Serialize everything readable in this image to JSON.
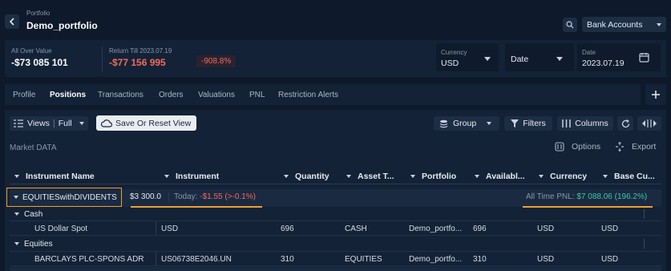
{
  "header": {
    "breadcrumb": "Portfolio",
    "title": "Demo_portfolio",
    "bank_accounts": "Bank Accounts"
  },
  "summary": {
    "all_over_label": "All Over Value",
    "all_over_value": "-$73 085 101",
    "return_label": "Return Till 2023.07.19",
    "return_value": "-$77 156 995",
    "return_pct": "-908.8%",
    "currency_label": "Currency",
    "currency_value": "USD",
    "date_select": "Date",
    "date_label": "Date",
    "date_value": "2023.07.19"
  },
  "tabs": [
    "Profile",
    "Positions",
    "Transactions",
    "Orders",
    "Valuations",
    "PNL",
    "Restriction Alerts"
  ],
  "toolbar": {
    "views": "Views",
    "views_mode": "Full",
    "save_reset": "Save Or Reset View",
    "group": "Group",
    "filters": "Filters",
    "columns": "Columns"
  },
  "market": {
    "title": "Market DATA",
    "options": "Options",
    "export": "Export"
  },
  "columns": [
    "Instrument Name",
    "Instrument",
    "Quantity",
    "Asset T...",
    "Portfolio",
    "Availabl...",
    "Currency",
    "Base Cu..."
  ],
  "group_row": {
    "name": "EQUITIESwithDIVIDENTS",
    "value": "$3 300.0",
    "today_label": "Today:",
    "today_value": "-$1.55 (>-0.1%)",
    "pnl_label": "All Time PNL:",
    "pnl_value": "$7 088.06 (196.2%)"
  },
  "subgroups": [
    {
      "name": "Cash",
      "rows": [
        {
          "name": "US Dollar Spot",
          "instrument": "USD",
          "quantity": "696",
          "asset": "CASH",
          "portfolio": "Demo_portfo...",
          "available": "696",
          "currency": "USD",
          "base": "USD"
        }
      ]
    },
    {
      "name": "Equities",
      "rows": [
        {
          "name": "BARCLAYS PLC-SPONS ADR",
          "instrument": "US06738E2046.UN",
          "quantity": "310",
          "asset": "EQUITIES",
          "portfolio": "Demo_portfo...",
          "available": "310",
          "currency": "USD",
          "base": "USD"
        }
      ]
    }
  ],
  "colors": {
    "negative": "#f26b5b",
    "positive": "#3ec7a6",
    "highlight": "#f0a030"
  }
}
